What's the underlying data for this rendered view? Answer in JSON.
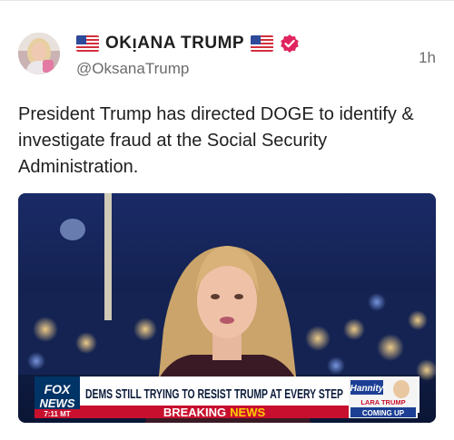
{
  "post": {
    "author": {
      "display_name": "OKᴉANA TRUMP",
      "handle": "@OksanaTrump",
      "verified": true,
      "flag_icon": "us-flag-icon"
    },
    "timestamp": "1h",
    "text": "President Trump has directed DOGE to identify & investigate fraud at the Social Security Administration."
  },
  "media": {
    "network_logo_line1": "FOX",
    "network_logo_line2": "NEWS",
    "time_label": "7:11 MT",
    "headline": "DEMS STILL TRYING TO RESIST TRUMP AT EVERY STEP",
    "banner_left": "BREAKING",
    "banner_right": "NEWS",
    "show_logo": "Hannity",
    "promo_line1": "LARA TRUMP",
    "promo_line2": "COMING UP"
  },
  "colors": {
    "verified_badge": "#e0245e",
    "breaking_red": "#c8102e",
    "news_yellow": "#ffcc00",
    "fox_blue": "#003366"
  }
}
